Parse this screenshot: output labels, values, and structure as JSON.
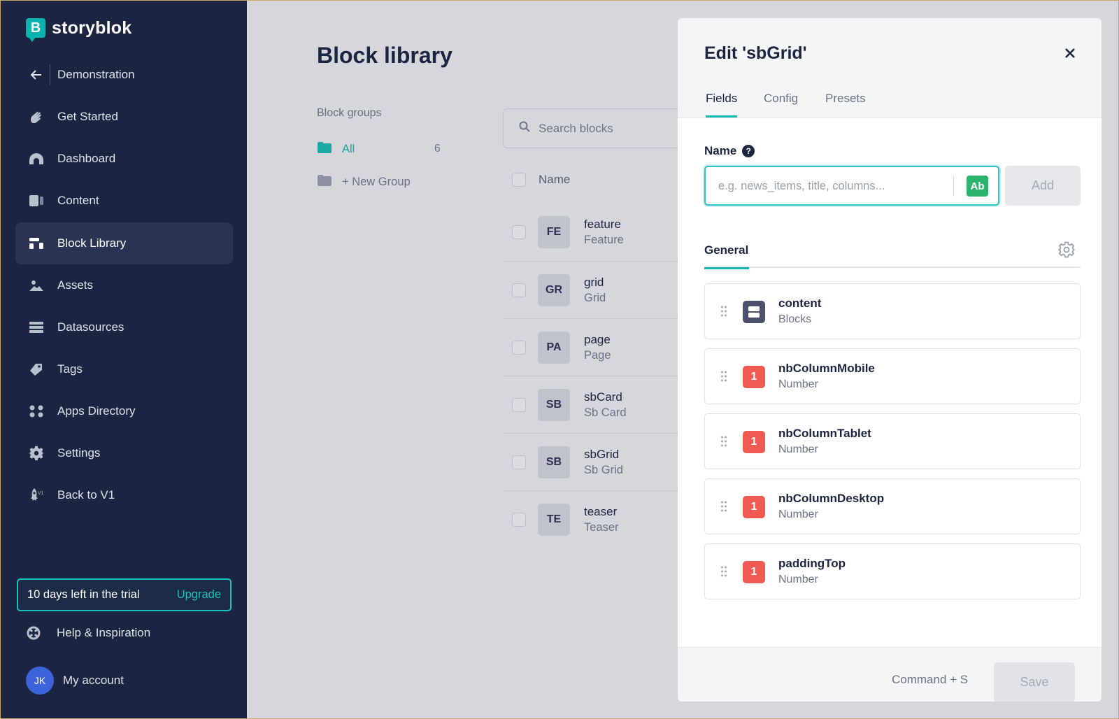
{
  "brand": {
    "logo_letter": "B",
    "name": "storyblok"
  },
  "sidebar": {
    "back_item": "Demonstration",
    "items": [
      {
        "label": "Get Started",
        "icon": "hand-wave-icon"
      },
      {
        "label": "Dashboard",
        "icon": "dashboard-gauge-icon"
      },
      {
        "label": "Content",
        "icon": "content-icon"
      },
      {
        "label": "Block Library",
        "icon": "block-library-icon",
        "active": true
      },
      {
        "label": "Assets",
        "icon": "assets-image-icon"
      },
      {
        "label": "Datasources",
        "icon": "datasources-icon"
      },
      {
        "label": "Tags",
        "icon": "tag-icon"
      },
      {
        "label": "Apps Directory",
        "icon": "apps-grid-icon"
      },
      {
        "label": "Settings",
        "icon": "gear-icon"
      },
      {
        "label": "Back to V1",
        "icon": "rocket-icon",
        "icon_badge": "V1"
      }
    ],
    "trial_text": "10 days left in the trial",
    "upgrade_label": "Upgrade",
    "help_label": "Help & Inspiration",
    "account": {
      "initials": "JK",
      "label": "My account"
    }
  },
  "main": {
    "title": "Block library",
    "groups_heading": "Block groups",
    "groups": [
      {
        "label": "All",
        "count": "6",
        "active": true
      },
      {
        "label": "+ New Group"
      }
    ],
    "search_placeholder": "Search blocks",
    "list_header": "Name",
    "blocks": [
      {
        "abbr": "FE",
        "name": "feature",
        "display": "Feature"
      },
      {
        "abbr": "GR",
        "name": "grid",
        "display": "Grid"
      },
      {
        "abbr": "PA",
        "name": "page",
        "display": "Page"
      },
      {
        "abbr": "SB",
        "name": "sbCard",
        "display": "Sb Card"
      },
      {
        "abbr": "SB",
        "name": "sbGrid",
        "display": "Sb Grid"
      },
      {
        "abbr": "TE",
        "name": "teaser",
        "display": "Teaser"
      }
    ]
  },
  "modal": {
    "title": "Edit 'sbGrid'",
    "tabs": [
      "Fields",
      "Config",
      "Presets"
    ],
    "active_tab": "Fields",
    "name_label": "Name",
    "help_glyph": "?",
    "name_placeholder": "e.g. news_items, title, columns...",
    "type_badge": "Ab",
    "add_label": "Add",
    "section_tab": "General",
    "fields": [
      {
        "name": "content",
        "type": "Blocks",
        "icon": "blocks-icon"
      },
      {
        "name": "nbColumnMobile",
        "type": "Number",
        "icon_text": "1"
      },
      {
        "name": "nbColumnTablet",
        "type": "Number",
        "icon_text": "1"
      },
      {
        "name": "nbColumnDesktop",
        "type": "Number",
        "icon_text": "1"
      },
      {
        "name": "paddingTop",
        "type": "Number",
        "icon_text": "1"
      }
    ],
    "shortcut": "Command + S",
    "save_label": "Save"
  },
  "colors": {
    "sidebar_bg": "#1b2440",
    "accent_teal": "#17b5b0",
    "number_red": "#ef5b53",
    "text_badge_green": "#2cb46c",
    "avatar_blue": "#3c63d9"
  }
}
